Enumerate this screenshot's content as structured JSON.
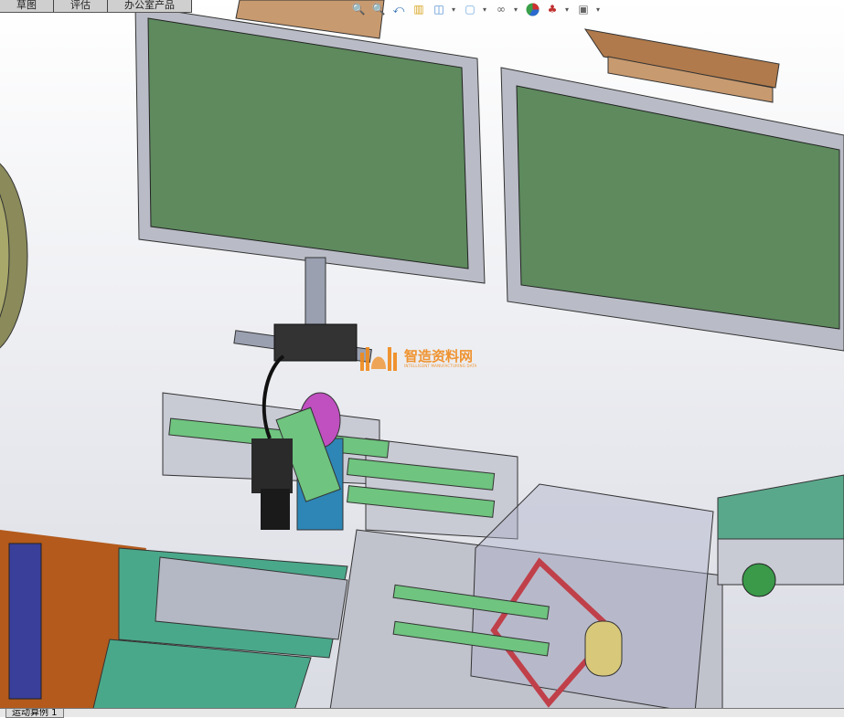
{
  "command_tabs": [
    {
      "label": "草图"
    },
    {
      "label": "评估"
    },
    {
      "label": "办公室产品"
    }
  ],
  "heads_up_toolbar": [
    {
      "icon": "zoom-to-fit-icon"
    },
    {
      "icon": "zoom-area-icon"
    },
    {
      "icon": "previous-view-icon"
    },
    {
      "icon": "section-view-icon"
    },
    {
      "icon": "view-orientation-icon",
      "dropdown": true
    },
    {
      "icon": "display-style-icon",
      "dropdown": true
    },
    {
      "icon": "hide-show-items-icon",
      "dropdown": true
    },
    {
      "icon": "edit-appearance-icon"
    },
    {
      "icon": "apply-scene-icon",
      "dropdown": true
    },
    {
      "icon": "view-settings-icon",
      "dropdown": true
    }
  ],
  "bottom_tabs": [
    {
      "label": "运动算例 1"
    }
  ],
  "watermark": {
    "title": "智造资料网",
    "subtitle": "INTELLIGENT MANUFACTURING DATA"
  },
  "colors": {
    "monitor_screen": "#5e8a5e",
    "monitor_frame": "#b9bcc6",
    "bracket": "#c89a6f",
    "rail": "#6fc47f",
    "base": "#b35a1c",
    "camera": "#2a2a2a",
    "mount_blue": "#2d86b5",
    "magenta": "#c04fc0"
  }
}
